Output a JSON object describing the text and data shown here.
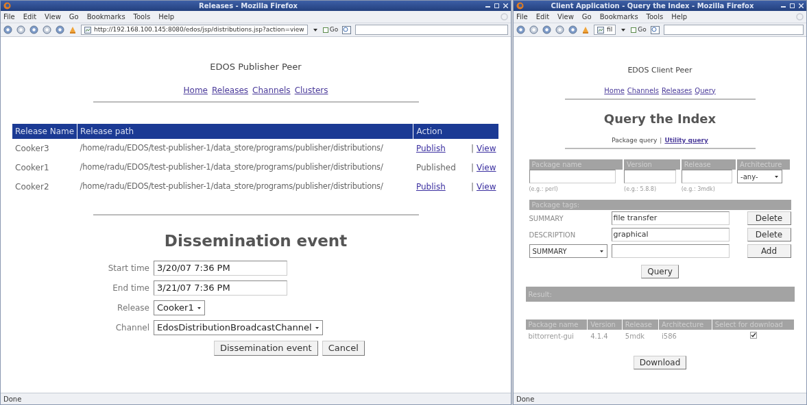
{
  "publisher_window": {
    "title": "Releases - Mozilla Firefox",
    "menu": [
      "File",
      "Edit",
      "View",
      "Go",
      "Bookmarks",
      "Tools",
      "Help"
    ],
    "url": "http://192.168.100.145:8080/edos/jsp/distributions.jsp?action=view",
    "go": "Go",
    "heading": "EDOS Publisher Peer",
    "nav_links": [
      "Home",
      "Releases",
      "Channels",
      "Clusters"
    ],
    "table": {
      "columns": [
        "Release Name",
        "Release path",
        "Action"
      ],
      "rows": [
        {
          "name": "Cooker3",
          "path": "/home/radu/EDOS/test-publisher-1/data_store/programs/publisher/distributions/",
          "actions": [
            {
              "kind": "link",
              "label": "Publish"
            },
            {
              "kind": "link",
              "label": "View"
            }
          ],
          "separator": "|"
        },
        {
          "name": "Cooker1",
          "path": "/home/radu/EDOS/test-publisher-1/data_store/programs/publisher/distributions/",
          "actions": [
            {
              "kind": "text",
              "label": "Published"
            },
            {
              "kind": "link",
              "label": "View"
            }
          ],
          "separator": "|"
        },
        {
          "name": "Cooker2",
          "path": "/home/radu/EDOS/test-publisher-1/data_store/programs/publisher/distributions/",
          "actions": [
            {
              "kind": "link",
              "label": "Publish"
            },
            {
              "kind": "link",
              "label": "View"
            }
          ],
          "separator": "|"
        }
      ]
    },
    "event": {
      "title": "Dissemination event",
      "fields": [
        {
          "label": "Start time",
          "kind": "input",
          "value": "3/20/07 7:36 PM"
        },
        {
          "label": "End time",
          "kind": "input",
          "value": "3/21/07 7:36 PM"
        },
        {
          "label": "Release",
          "kind": "select",
          "value": "Cooker1"
        },
        {
          "label": "Channel",
          "kind": "select",
          "value": "EdosDistributionBroadcastChannel"
        }
      ],
      "buttons": [
        "Dissemination event",
        "Cancel"
      ]
    },
    "status_bar": "Done"
  },
  "client_window": {
    "title": "Client Application - Query the Index - Mozilla Firefox",
    "menu": [
      "File",
      "Edit",
      "View",
      "Go",
      "Bookmarks",
      "Tools",
      "Help"
    ],
    "url": "fil",
    "go": "Go",
    "heading": "EDOS Client Peer",
    "nav_links": [
      "Home",
      "Channels",
      "Releases",
      "Query"
    ],
    "page_title": "Query the Index",
    "query_tabs": [
      {
        "label": "Package query",
        "selected": true
      },
      {
        "label": "Utility query",
        "selected": false
      }
    ],
    "query_tabs_separator": "|",
    "search": {
      "columns": [
        "Package name",
        "Version",
        "Release",
        "Architecture"
      ],
      "architecture": "-any-",
      "hints": [
        "(e.g.: perl)",
        "(e.g.: 5.8.8)",
        "(e.g.: 3mdk)"
      ]
    },
    "tags": {
      "header": "Package tags:",
      "rows": [
        {
          "tag": "SUMMARY",
          "value": "file transfer",
          "button": "Delete"
        },
        {
          "tag": "DESCRIPTION",
          "value": "graphical",
          "button": "Delete"
        }
      ],
      "new_tag": {
        "tag": "SUMMARY",
        "button": "Add"
      }
    },
    "query_button": "Query",
    "result": {
      "header": "Result:",
      "columns": [
        "Package name",
        "Version",
        "Release",
        "Architecture",
        "Select for download"
      ],
      "rows": [
        {
          "cells": [
            "bittorrent-gui",
            "4.1.4",
            "5mdk",
            "i586"
          ],
          "selected": true
        }
      ]
    },
    "download_button": "Download",
    "status_bar": "Done"
  }
}
